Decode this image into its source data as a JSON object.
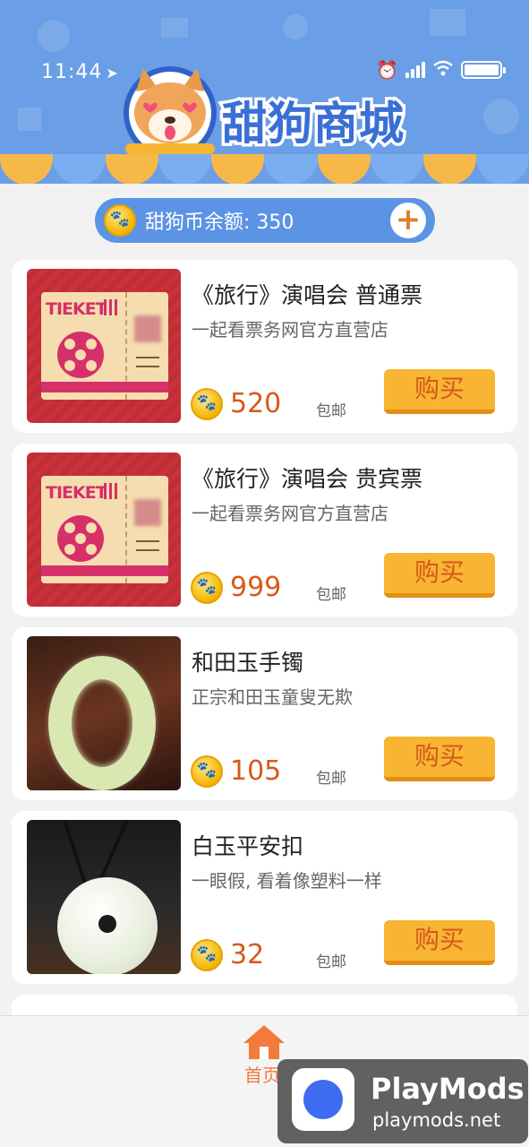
{
  "status_bar": {
    "time": "11:44"
  },
  "header": {
    "app_title": "甜狗商城"
  },
  "balance": {
    "label": "甜狗币余额: 350"
  },
  "products": [
    {
      "title": "《旅行》演唱会  普通票",
      "subtitle": "一起看票务网官方直营店",
      "price": "520",
      "shipping": "包邮",
      "buy_label": "购买",
      "image": "ticket-image",
      "ticket_text": "TIEKET"
    },
    {
      "title": "《旅行》演唱会  贵宾票",
      "subtitle": "一起看票务网官方直营店",
      "price": "999",
      "shipping": "包邮",
      "buy_label": "购买",
      "image": "ticket-image",
      "ticket_text": "TIEKET"
    },
    {
      "title": "和田玉手镯",
      "subtitle": "正宗和田玉童叟无欺",
      "price": "105",
      "shipping": "包邮",
      "buy_label": "购买",
      "image": "jade-bangle-image"
    },
    {
      "title": "白玉平安扣",
      "subtitle": "一眼假, 看着像塑料一样",
      "price": "32",
      "shipping": "包邮",
      "buy_label": "购买",
      "image": "jade-pendant-image"
    }
  ],
  "bottom_nav": {
    "home_label": "首页"
  },
  "watermark": {
    "brand": "PlayMods",
    "url": "playmods.net"
  },
  "colors": {
    "header_blue": "#6a9ee6",
    "accent_orange": "#f7b532",
    "price_red": "#d65a1a",
    "nav_orange": "#f27a3c"
  }
}
